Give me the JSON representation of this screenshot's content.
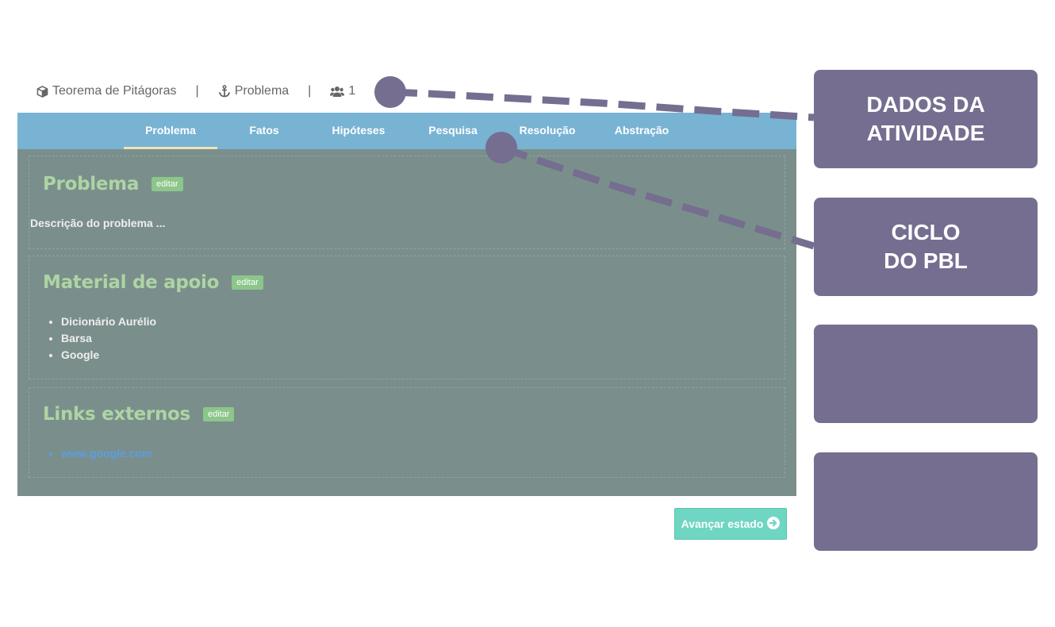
{
  "activity": {
    "title": "Teorema de Pitágoras",
    "separator": "|",
    "phase": "Problema",
    "members": "1"
  },
  "tabs": [
    {
      "label": "Problema",
      "active": true
    },
    {
      "label": "Fatos",
      "active": false
    },
    {
      "label": "Hipóteses",
      "active": false
    },
    {
      "label": "Pesquisa",
      "active": false
    },
    {
      "label": "Resolução",
      "active": false
    },
    {
      "label": "Abstração",
      "active": false
    }
  ],
  "sections": {
    "problem": {
      "title": "Problema",
      "edit_label": "editar",
      "text": "Descrição do problema ..."
    },
    "support": {
      "title": "Material de apoio",
      "edit_label": "editar",
      "items": [
        "Dicionário Aurélio",
        "Barsa",
        "Google"
      ]
    },
    "links": {
      "title": "Links externos",
      "edit_label": "editar",
      "items": [
        "www.google.com"
      ]
    }
  },
  "advance_button": {
    "label": "Avançar estado"
  },
  "callouts": [
    {
      "text": "DADOS DA\nATIVIDADE"
    },
    {
      "text": "CICLO\nDO PBL"
    },
    {
      "text": ""
    },
    {
      "text": ""
    }
  ],
  "icons": {
    "activity": "cube-icon",
    "phase": "anchor-icon",
    "members": "users-icon",
    "advance": "arrow-circle-right-icon"
  },
  "colors": {
    "tab_bar": "#78b3d3",
    "active_tab_underline": "#f1e2b6",
    "panel": "#7a8f8c",
    "section_title": "#aed4a3",
    "edit_badge": "#8cc68a",
    "link": "#5b9ee0",
    "advance_button": "#6ed6c2",
    "callout": "#756e90"
  }
}
